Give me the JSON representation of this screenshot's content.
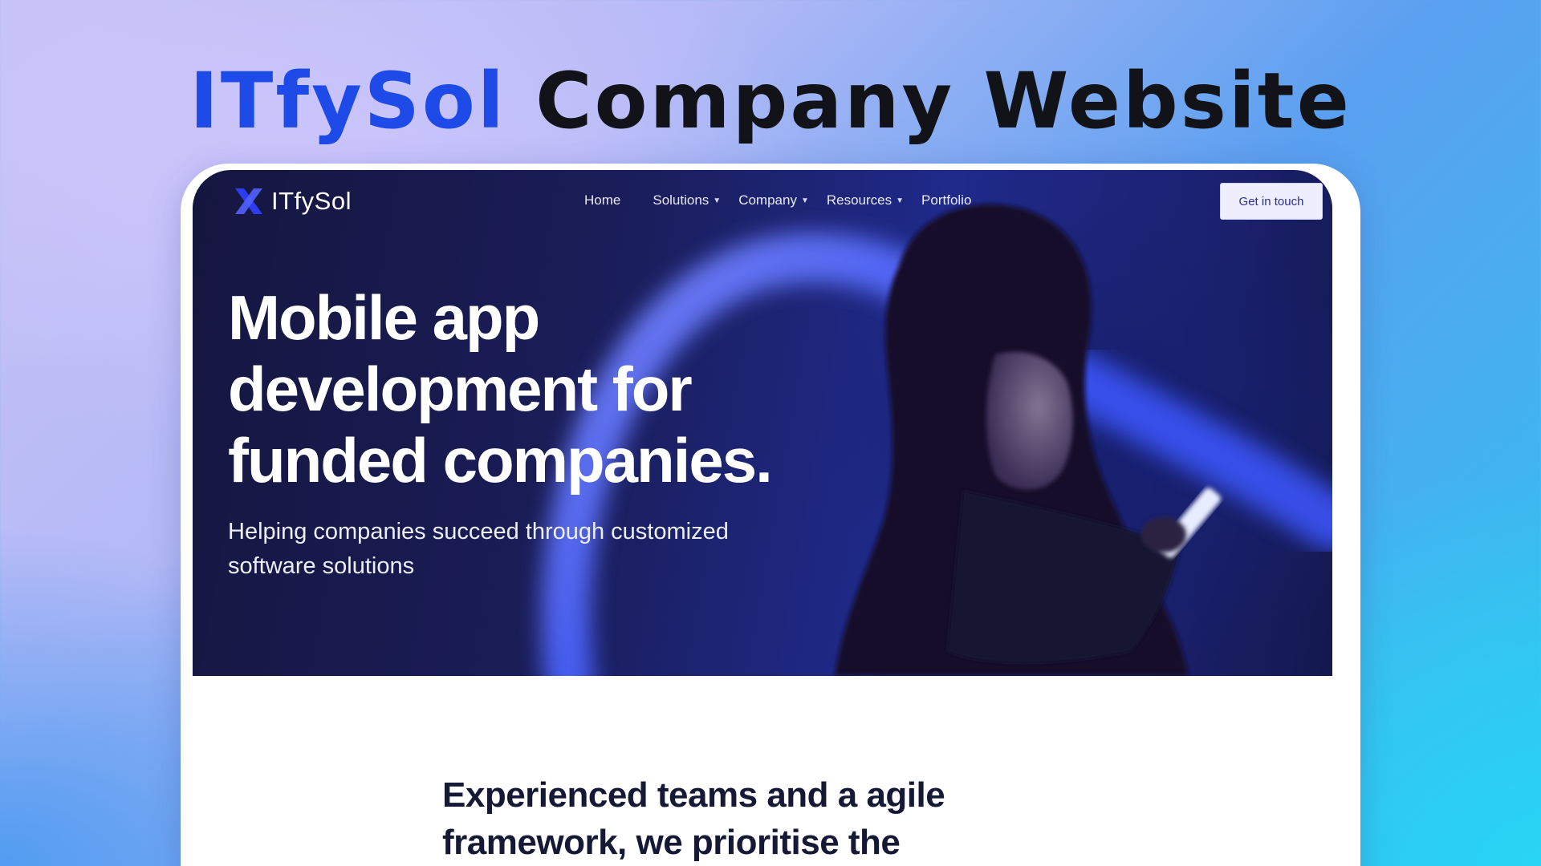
{
  "banner": {
    "brand": "ITfySol",
    "title_rest": "Company Website"
  },
  "site": {
    "logo_text": "ITfySol",
    "nav": [
      {
        "label": "Home",
        "dropdown": false
      },
      {
        "label": "Solutions",
        "dropdown": true
      },
      {
        "label": "Company",
        "dropdown": true
      },
      {
        "label": "Resources",
        "dropdown": true
      },
      {
        "label": "Portfolio",
        "dropdown": false
      }
    ],
    "cta_label": "Get in touch"
  },
  "hero": {
    "heading": "Mobile app development for funded companies.",
    "subheading": "Helping companies succeed through customized software solutions"
  },
  "section": {
    "heading": "Experienced teams and a agile framework, we prioritise the"
  },
  "colors": {
    "brand_blue": "#1e4be8",
    "hero_dark": "#15163f",
    "cta_bg": "#eeeefc"
  }
}
